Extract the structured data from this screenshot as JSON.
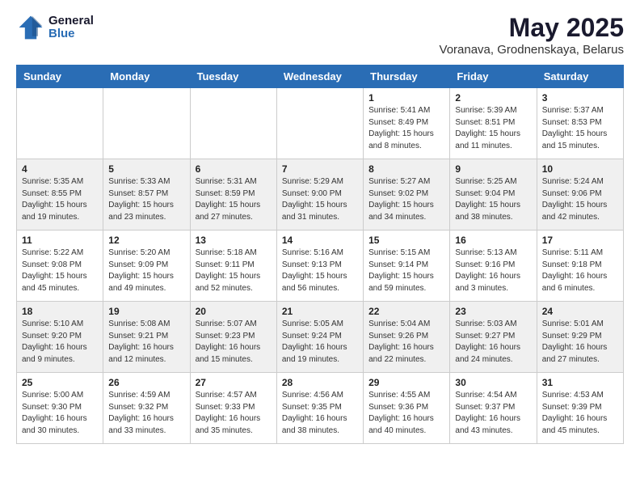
{
  "logo": {
    "general": "General",
    "blue": "Blue"
  },
  "header": {
    "title": "May 2025",
    "subtitle": "Voranava, Grodnenskaya, Belarus"
  },
  "days_of_week": [
    "Sunday",
    "Monday",
    "Tuesday",
    "Wednesday",
    "Thursday",
    "Friday",
    "Saturday"
  ],
  "weeks": [
    [
      {
        "num": "",
        "info": ""
      },
      {
        "num": "",
        "info": ""
      },
      {
        "num": "",
        "info": ""
      },
      {
        "num": "",
        "info": ""
      },
      {
        "num": "1",
        "info": "Sunrise: 5:41 AM\nSunset: 8:49 PM\nDaylight: 15 hours\nand 8 minutes."
      },
      {
        "num": "2",
        "info": "Sunrise: 5:39 AM\nSunset: 8:51 PM\nDaylight: 15 hours\nand 11 minutes."
      },
      {
        "num": "3",
        "info": "Sunrise: 5:37 AM\nSunset: 8:53 PM\nDaylight: 15 hours\nand 15 minutes."
      }
    ],
    [
      {
        "num": "4",
        "info": "Sunrise: 5:35 AM\nSunset: 8:55 PM\nDaylight: 15 hours\nand 19 minutes."
      },
      {
        "num": "5",
        "info": "Sunrise: 5:33 AM\nSunset: 8:57 PM\nDaylight: 15 hours\nand 23 minutes."
      },
      {
        "num": "6",
        "info": "Sunrise: 5:31 AM\nSunset: 8:59 PM\nDaylight: 15 hours\nand 27 minutes."
      },
      {
        "num": "7",
        "info": "Sunrise: 5:29 AM\nSunset: 9:00 PM\nDaylight: 15 hours\nand 31 minutes."
      },
      {
        "num": "8",
        "info": "Sunrise: 5:27 AM\nSunset: 9:02 PM\nDaylight: 15 hours\nand 34 minutes."
      },
      {
        "num": "9",
        "info": "Sunrise: 5:25 AM\nSunset: 9:04 PM\nDaylight: 15 hours\nand 38 minutes."
      },
      {
        "num": "10",
        "info": "Sunrise: 5:24 AM\nSunset: 9:06 PM\nDaylight: 15 hours\nand 42 minutes."
      }
    ],
    [
      {
        "num": "11",
        "info": "Sunrise: 5:22 AM\nSunset: 9:08 PM\nDaylight: 15 hours\nand 45 minutes."
      },
      {
        "num": "12",
        "info": "Sunrise: 5:20 AM\nSunset: 9:09 PM\nDaylight: 15 hours\nand 49 minutes."
      },
      {
        "num": "13",
        "info": "Sunrise: 5:18 AM\nSunset: 9:11 PM\nDaylight: 15 hours\nand 52 minutes."
      },
      {
        "num": "14",
        "info": "Sunrise: 5:16 AM\nSunset: 9:13 PM\nDaylight: 15 hours\nand 56 minutes."
      },
      {
        "num": "15",
        "info": "Sunrise: 5:15 AM\nSunset: 9:14 PM\nDaylight: 15 hours\nand 59 minutes."
      },
      {
        "num": "16",
        "info": "Sunrise: 5:13 AM\nSunset: 9:16 PM\nDaylight: 16 hours\nand 3 minutes."
      },
      {
        "num": "17",
        "info": "Sunrise: 5:11 AM\nSunset: 9:18 PM\nDaylight: 16 hours\nand 6 minutes."
      }
    ],
    [
      {
        "num": "18",
        "info": "Sunrise: 5:10 AM\nSunset: 9:20 PM\nDaylight: 16 hours\nand 9 minutes."
      },
      {
        "num": "19",
        "info": "Sunrise: 5:08 AM\nSunset: 9:21 PM\nDaylight: 16 hours\nand 12 minutes."
      },
      {
        "num": "20",
        "info": "Sunrise: 5:07 AM\nSunset: 9:23 PM\nDaylight: 16 hours\nand 15 minutes."
      },
      {
        "num": "21",
        "info": "Sunrise: 5:05 AM\nSunset: 9:24 PM\nDaylight: 16 hours\nand 19 minutes."
      },
      {
        "num": "22",
        "info": "Sunrise: 5:04 AM\nSunset: 9:26 PM\nDaylight: 16 hours\nand 22 minutes."
      },
      {
        "num": "23",
        "info": "Sunrise: 5:03 AM\nSunset: 9:27 PM\nDaylight: 16 hours\nand 24 minutes."
      },
      {
        "num": "24",
        "info": "Sunrise: 5:01 AM\nSunset: 9:29 PM\nDaylight: 16 hours\nand 27 minutes."
      }
    ],
    [
      {
        "num": "25",
        "info": "Sunrise: 5:00 AM\nSunset: 9:30 PM\nDaylight: 16 hours\nand 30 minutes."
      },
      {
        "num": "26",
        "info": "Sunrise: 4:59 AM\nSunset: 9:32 PM\nDaylight: 16 hours\nand 33 minutes."
      },
      {
        "num": "27",
        "info": "Sunrise: 4:57 AM\nSunset: 9:33 PM\nDaylight: 16 hours\nand 35 minutes."
      },
      {
        "num": "28",
        "info": "Sunrise: 4:56 AM\nSunset: 9:35 PM\nDaylight: 16 hours\nand 38 minutes."
      },
      {
        "num": "29",
        "info": "Sunrise: 4:55 AM\nSunset: 9:36 PM\nDaylight: 16 hours\nand 40 minutes."
      },
      {
        "num": "30",
        "info": "Sunrise: 4:54 AM\nSunset: 9:37 PM\nDaylight: 16 hours\nand 43 minutes."
      },
      {
        "num": "31",
        "info": "Sunrise: 4:53 AM\nSunset: 9:39 PM\nDaylight: 16 hours\nand 45 minutes."
      }
    ]
  ]
}
